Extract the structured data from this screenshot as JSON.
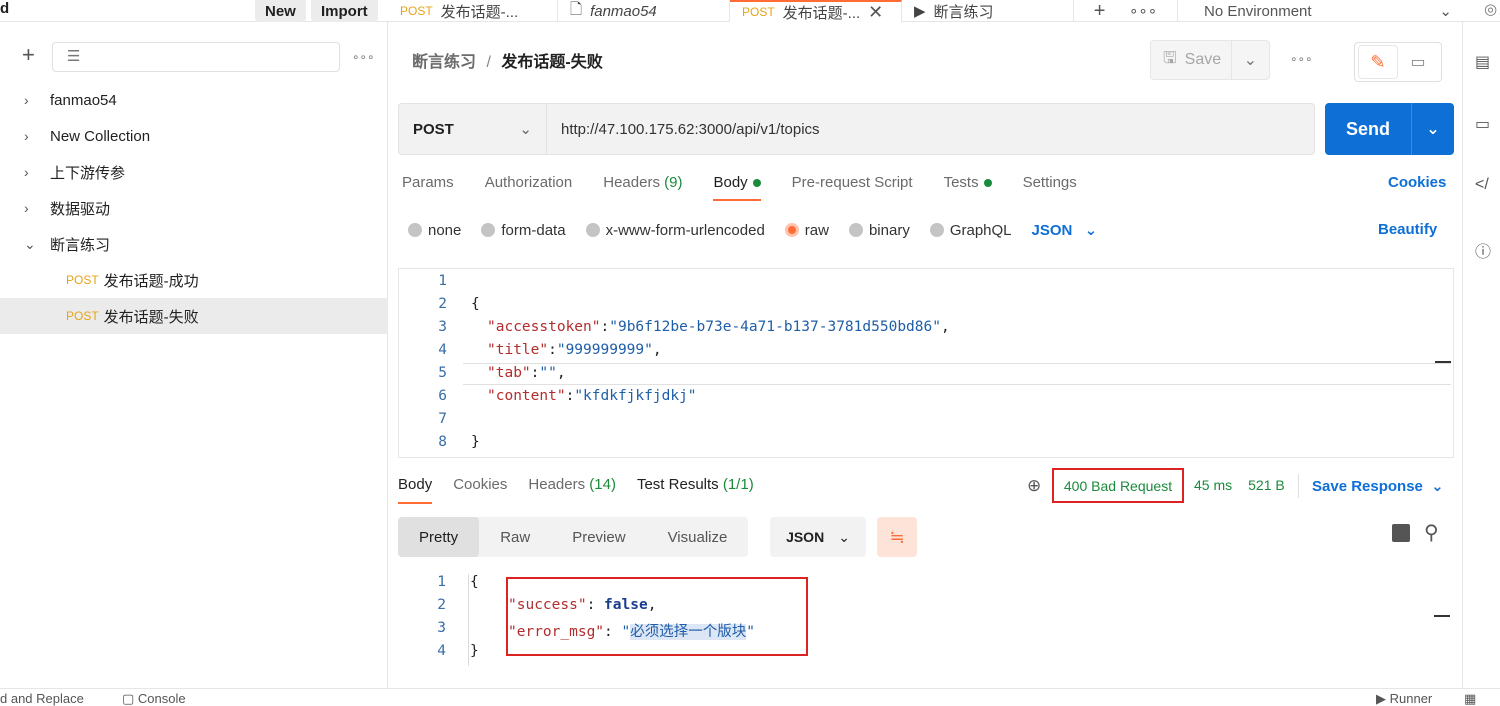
{
  "topbar": {
    "new_label": "New",
    "import_label": "Import",
    "tabs": [
      {
        "method": "POST",
        "title": "发布话题-..."
      },
      {
        "method": "",
        "title": "fanmao54"
      },
      {
        "method": "POST",
        "title": "发布话题-..."
      },
      {
        "method": "",
        "title": "断言练习"
      }
    ],
    "environment": "No Environment"
  },
  "sidebar": {
    "items": [
      {
        "label": "fanmao54"
      },
      {
        "label": "New Collection"
      },
      {
        "label": "上下游传参"
      },
      {
        "label": "数据驱动"
      },
      {
        "label": "断言练习"
      }
    ],
    "children": [
      {
        "method": "POST",
        "label": "发布话题-成功"
      },
      {
        "method": "POST",
        "label": "发布话题-失败"
      }
    ]
  },
  "request": {
    "breadcrumb_parent": "断言练习",
    "breadcrumb_sep": "/",
    "breadcrumb_current": "发布话题-失败",
    "save_label": "Save",
    "method": "POST",
    "url": "http://47.100.175.62:3000/api/v1/topics",
    "send_label": "Send",
    "tabs": {
      "params": "Params",
      "authorization": "Authorization",
      "headers": "Headers",
      "headers_count": "(9)",
      "body": "Body",
      "prerequest": "Pre-request Script",
      "tests": "Tests",
      "settings": "Settings"
    },
    "cookies_label": "Cookies",
    "body_options": {
      "none": "none",
      "formdata": "form-data",
      "urlencoded": "x-www-form-urlencoded",
      "raw": "raw",
      "binary": "binary",
      "graphql": "GraphQL",
      "format": "JSON"
    },
    "beautify_label": "Beautify",
    "body_lines": [
      "1",
      "2",
      "3",
      "4",
      "5",
      "6",
      "7",
      "8"
    ],
    "body_code": {
      "open": "{",
      "k1": "\"accesstoken\"",
      "v1": "\"9b6f12be-b73e-4a71-b137-3781d550bd86\"",
      "k2": "\"title\"",
      "v2": "\"999999999\"",
      "k3": "\"tab\"",
      "v3": "\"\"",
      "k4": "\"content\"",
      "v4": "\"kfdkfjkfjdkj\"",
      "close": "}"
    }
  },
  "response": {
    "tabs": {
      "body": "Body",
      "cookies": "Cookies",
      "headers": "Headers",
      "headers_count": "(14)",
      "tests": "Test Results",
      "tests_count": "(1/1)"
    },
    "status": "400 Bad Request",
    "time": "45 ms",
    "size": "521 B",
    "save_label": "Save Response",
    "view_tabs": [
      "Pretty",
      "Raw",
      "Preview",
      "Visualize"
    ],
    "format": "JSON",
    "lines": [
      "1",
      "2",
      "3",
      "4"
    ],
    "code": {
      "open": "{",
      "k1": "\"success\"",
      "v1": "false",
      "k2": "\"error_msg\"",
      "v2": "必须选择一个版块",
      "close": "}"
    }
  },
  "footer": {
    "find_replace": "d and Replace",
    "console": "Console",
    "runner": "Runner"
  },
  "colors": {
    "accent": "#ff6c37",
    "send": "#0e6fd6",
    "success": "#1c8a3c",
    "highlight_box": "#dd2222"
  }
}
